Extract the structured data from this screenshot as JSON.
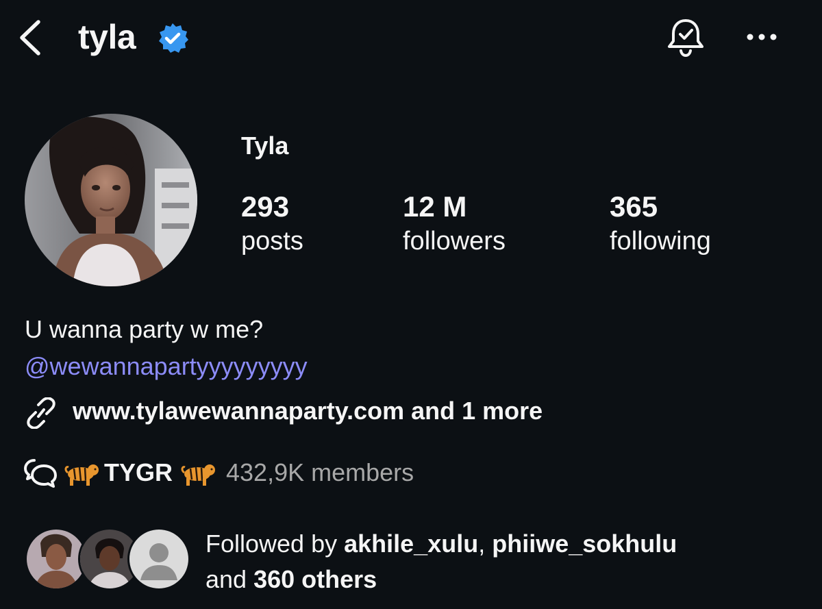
{
  "header": {
    "username": "tyla",
    "icons": {
      "back": "back-chevron-icon",
      "verified": "verified-badge-icon",
      "notifications": "bell-check-icon",
      "more": "more-horizontal-icon"
    },
    "accent": "#3897f0"
  },
  "profile": {
    "display_name": "Tyla",
    "stats": [
      {
        "value": "293",
        "label": "posts"
      },
      {
        "value": "12 M",
        "label": "followers"
      },
      {
        "value": "365",
        "label": "following"
      }
    ],
    "bio": "U wanna party w me?",
    "mention": "@wewannapartyyyyyyyyy",
    "mention_color": "#8c8cf8",
    "link": "www.tylawewannaparty.com and 1 more",
    "channel": {
      "name": "TYGR",
      "members": "432,9K members",
      "icon": "broadcast-channel-icon",
      "emoji": "tiger"
    }
  },
  "followed_by": {
    "prefix": "Followed by ",
    "user1": "akhile_xulu",
    "separator": ", ",
    "user2": "phiiwe_sokhulu",
    "and": "and ",
    "others": "360 others"
  },
  "colors": {
    "background": "#0c1014",
    "text": "#f5f5f5",
    "muted": "#a8a8a8"
  }
}
